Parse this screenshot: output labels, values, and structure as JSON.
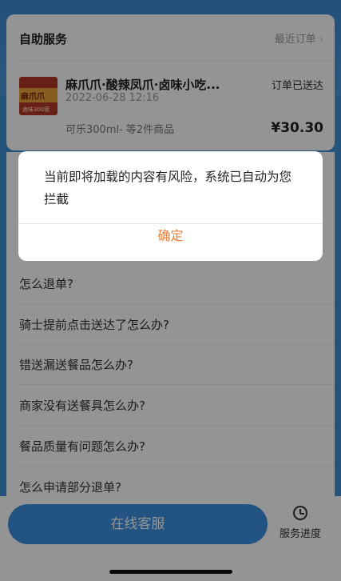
{
  "service": {
    "title": "自助服务",
    "recent_orders_label": "最近订单",
    "chevron": "›"
  },
  "order": {
    "store_name": "麻爪爪·酸辣凤爪·卤味小吃...",
    "time": "2022-06-28 12:16",
    "status": "订单已送达",
    "items_summary": "可乐300ml- 等2件商品",
    "price": "¥30.30",
    "thumb_text": "麻爪爪",
    "thumb_sub": "卤味300家"
  },
  "faq": {
    "items": [
      "怎么退单?",
      "骑士提前点击送达了怎么办?",
      "错送漏送餐品怎么办?",
      "商家没有送餐具怎么办?",
      "餐品质量有问题怎么办?",
      "怎么申请部分退单?"
    ]
  },
  "bottom": {
    "online_service": "在线客服",
    "progress": "服务进度"
  },
  "dialog": {
    "message": "当前即将加载的内容有风险，系统已自动为您拦截",
    "confirm": "确定"
  },
  "colors": {
    "accent": "#3d8fe0",
    "confirm": "#f07c30"
  }
}
